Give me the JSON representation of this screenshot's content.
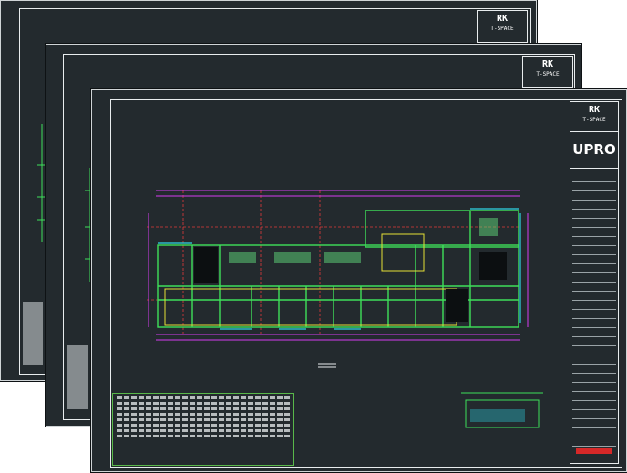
{
  "sheets": [
    {
      "id": "back",
      "logo_text": "RK",
      "logo_sub": "T-SPACE"
    },
    {
      "id": "middle",
      "logo_text": "RK",
      "logo_sub": "T-SPACE"
    },
    {
      "id": "front",
      "logo_text": "RK",
      "logo_sub": "T-SPACE",
      "brand": "UPRO"
    }
  ],
  "colors": {
    "sheet_bg": "#232a2e",
    "frame": "#e8ecee",
    "wall_green": "#3ee05a",
    "dimension_magenta": "#d43cf0",
    "grid_red": "#e23b3b",
    "room_yellow": "#e6e035",
    "window_cyan": "#2fd6e6",
    "stamp_red": "#d62828"
  },
  "icons": {
    "logo": "company-logo-icon",
    "north_arrow": "north-arrow-icon"
  }
}
